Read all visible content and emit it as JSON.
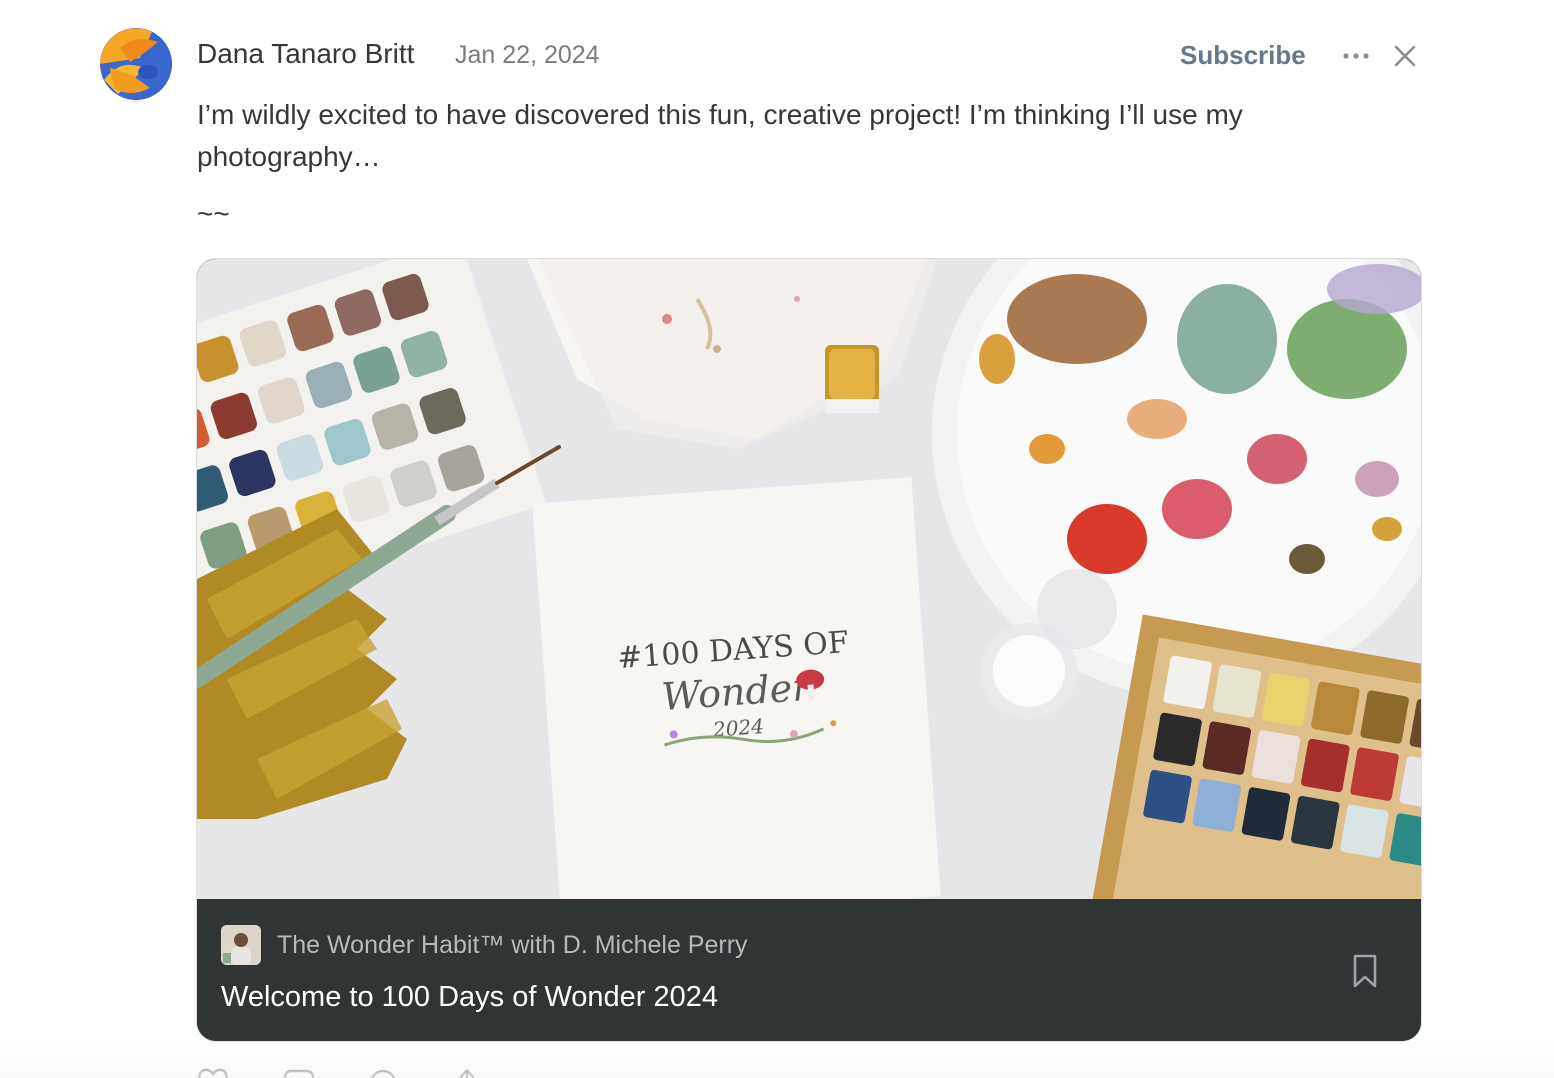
{
  "post": {
    "author": "Dana Tanaro Britt",
    "date": "Jan 22, 2024",
    "subscribe_label": "Subscribe",
    "body": "I’m wildly excited to have discovered this fun, creative project! I’m thinking I’ll use my photography…",
    "separator": "~~"
  },
  "card": {
    "publication": "The Wonder Habit™ with D. Michele Perry",
    "title": "Welcome to 100 Days of Wonder 2024",
    "image_lettering": "#100 DAYS OF Wonder 2024"
  },
  "icons": {
    "more": "ellipsis-icon",
    "close": "close-icon",
    "bookmark": "bookmark-icon",
    "actions": [
      "heart-icon",
      "comment-icon",
      "restack-icon",
      "share-icon"
    ]
  },
  "colors": {
    "subscribe": "#66788a",
    "card_footer": "#2f3435",
    "text": "#363737"
  }
}
